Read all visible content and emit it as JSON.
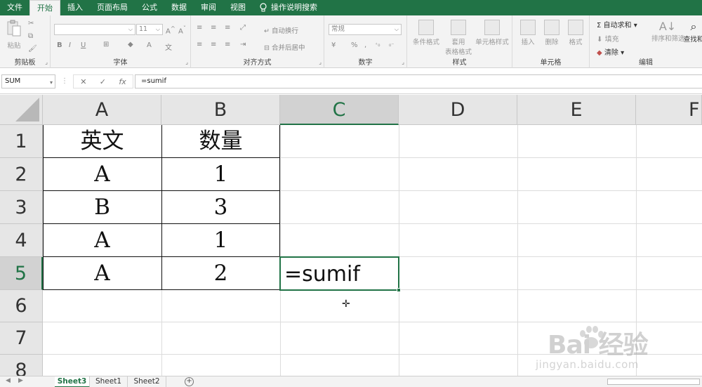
{
  "ribbon_tabs": [
    "文件",
    "开始",
    "插入",
    "页面布局",
    "公式",
    "数据",
    "审阅",
    "视图"
  ],
  "tell_me": "操作说明搜索",
  "groups": {
    "clipboard": {
      "paste": "粘贴",
      "label": "剪贴板"
    },
    "font": {
      "size": "11",
      "bold": "B",
      "italic": "I",
      "underline": "U",
      "font_color": "A",
      "label": "字体"
    },
    "alignment": {
      "wrap": "自动换行",
      "merge": "合并后居中",
      "label": "对齐方式"
    },
    "number": {
      "format": "常规",
      "percent": "%",
      "comma": ",",
      "label": "数字"
    },
    "styles": {
      "conditional": "条件格式",
      "table_l1": "套用",
      "table_l2": "表格格式",
      "cell_styles": "单元格样式",
      "label": "样式"
    },
    "cells": {
      "insert": "插入",
      "delete": "删除",
      "format": "格式",
      "label": "单元格"
    },
    "editing": {
      "autosum": "自动求和",
      "fill": "填充",
      "clear": "清除",
      "sort": "排序和筛选",
      "find": "查找和",
      "label": "编辑"
    }
  },
  "formula_bar": {
    "name_box": "SUM",
    "cancel": "✕",
    "enter": "✓",
    "fx": "fx",
    "formula": "=sumif"
  },
  "columns": [
    "A",
    "B",
    "C",
    "D",
    "E",
    "F"
  ],
  "rows": [
    "1",
    "2",
    "3",
    "4",
    "5",
    "6",
    "7",
    "8"
  ],
  "cells": {
    "A1": "英文",
    "B1": "数量",
    "A2": "A",
    "B2": "1",
    "A3": "B",
    "B3": "3",
    "A4": "A",
    "B4": "1",
    "A5": "A",
    "B5": "2",
    "C5": "=sumif"
  },
  "sheets": [
    "Sheet3",
    "Sheet1",
    "Sheet2"
  ],
  "add_sheet": "+",
  "watermark": {
    "text": "Bai 经验",
    "url": "jingyan.baidu.com"
  },
  "colors": {
    "accent": "#217346",
    "header_bg": "#e6e6e6"
  }
}
